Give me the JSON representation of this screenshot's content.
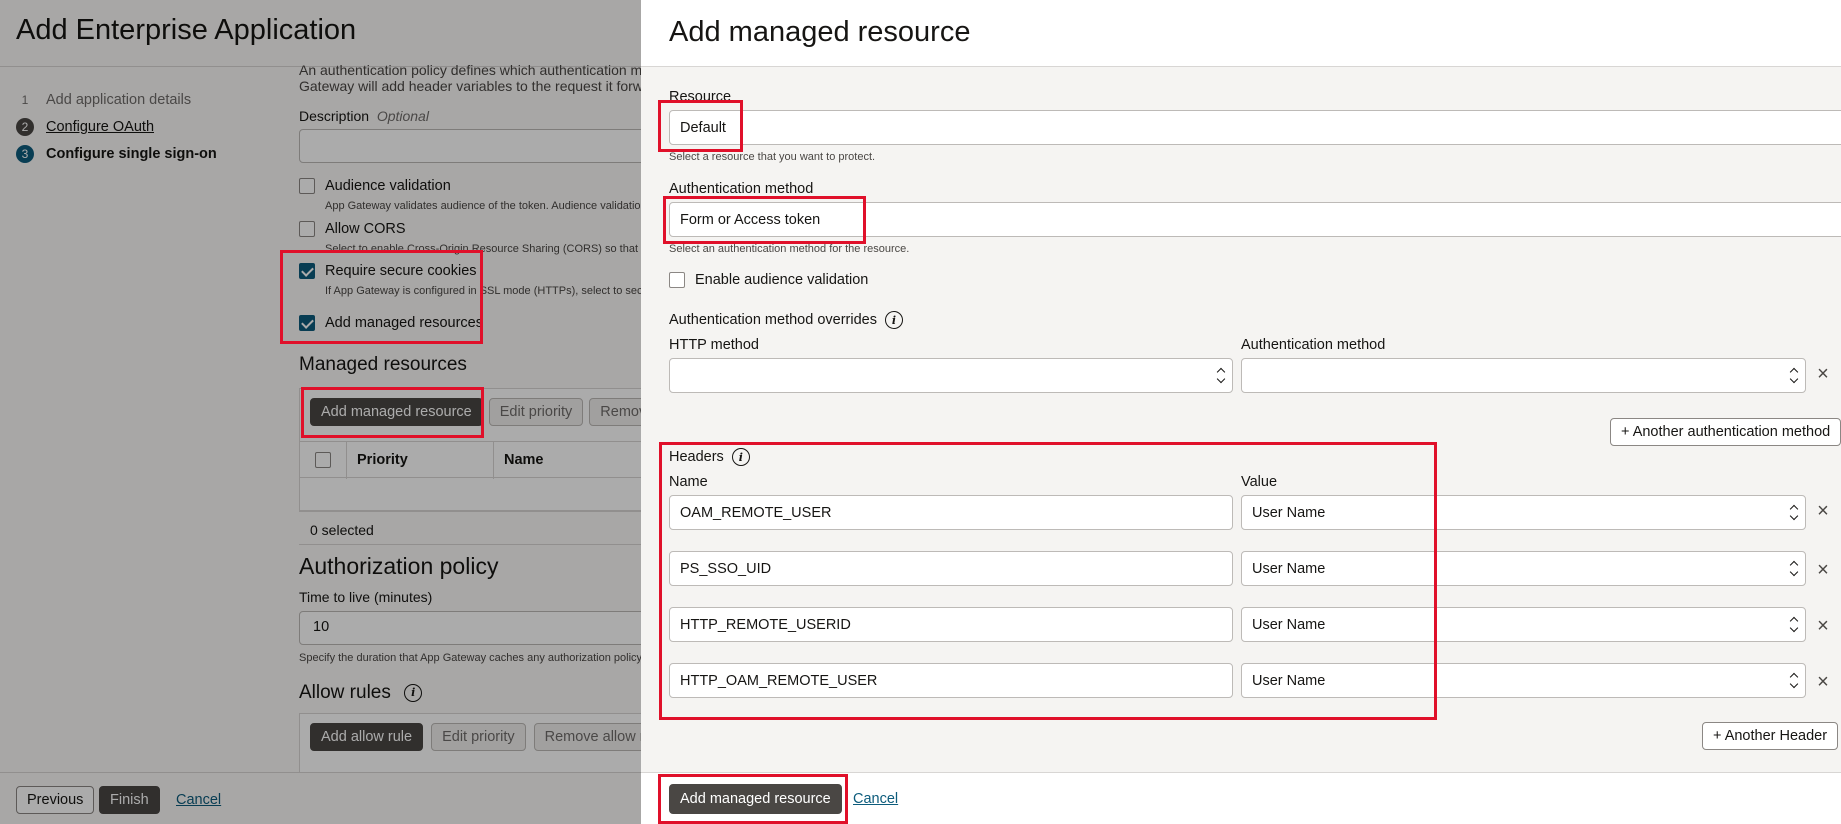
{
  "background": {
    "title": "Add Enterprise Application",
    "steps": [
      {
        "num": "1",
        "label": "Add application details"
      },
      {
        "num": "2",
        "label": "Configure OAuth"
      },
      {
        "num": "3",
        "label": "Configure single sign-on"
      }
    ],
    "intro_line1": "An authentication policy defines which authentication m",
    "intro_line2": "Gateway will add header variables to the request it forw",
    "description_label": "Description",
    "description_optional": "Optional",
    "audience_validation": {
      "label": "Audience validation",
      "help": "App Gateway validates audience of the token. Audience validatio"
    },
    "allow_cors": {
      "label": "Allow CORS",
      "help": "Select to enable Cross-Origin Resource Sharing (CORS) so that"
    },
    "secure_cookies": {
      "label": "Require secure cookies",
      "help": "If App Gateway is configured in SSL mode (HTTPs), select to sec"
    },
    "add_managed": {
      "label": "Add managed resources"
    },
    "managed_resources_title": "Managed resources",
    "managed_toolbar": {
      "add": "Add managed resource",
      "edit": "Edit priority",
      "remove": "Remov"
    },
    "table_headers": {
      "priority": "Priority",
      "name": "Name"
    },
    "selected_count": "0 selected",
    "authorization_title": "Authorization policy",
    "ttl_label": "Time to live (minutes)",
    "ttl_value": "10",
    "ttl_help": "Specify the duration that App Gateway caches any authorization policy",
    "allow_rules_title": "Allow rules",
    "allow_toolbar": {
      "add": "Add allow rule",
      "edit": "Edit priority",
      "remove": "Remove allow r"
    },
    "footer": {
      "previous": "Previous",
      "finish": "Finish",
      "cancel": "Cancel"
    }
  },
  "drawer": {
    "title": "Add managed resource",
    "resource": {
      "label": "Resource",
      "value": "Default",
      "help": "Select a resource that you want to protect."
    },
    "auth_method": {
      "label": "Authentication method",
      "value": "Form or Access token",
      "help": "Select an authentication method for the resource."
    },
    "enable_audience": "Enable audience validation",
    "overrides": {
      "label": "Authentication method overrides",
      "http_method_label": "HTTP method",
      "auth_method_label": "Authentication method",
      "http_method_value": "",
      "auth_method_value": ""
    },
    "another_auth_button": "+ Another authentication method",
    "headers": {
      "label": "Headers",
      "name_col": "Name",
      "value_col": "Value",
      "rows": [
        {
          "name": "OAM_REMOTE_USER",
          "value": "User Name"
        },
        {
          "name": "PS_SSO_UID",
          "value": "User Name"
        },
        {
          "name": "HTTP_REMOTE_USERID",
          "value": "User Name"
        },
        {
          "name": "HTTP_OAM_REMOTE_USER",
          "value": "User Name"
        }
      ]
    },
    "another_header_button": "+ Another Header",
    "footer": {
      "submit": "Add managed resource",
      "cancel": "Cancel"
    }
  },
  "colors": {
    "highlight": "#e0102a",
    "primary_dark": "#4a4744",
    "accent": "#0d5c7c"
  }
}
